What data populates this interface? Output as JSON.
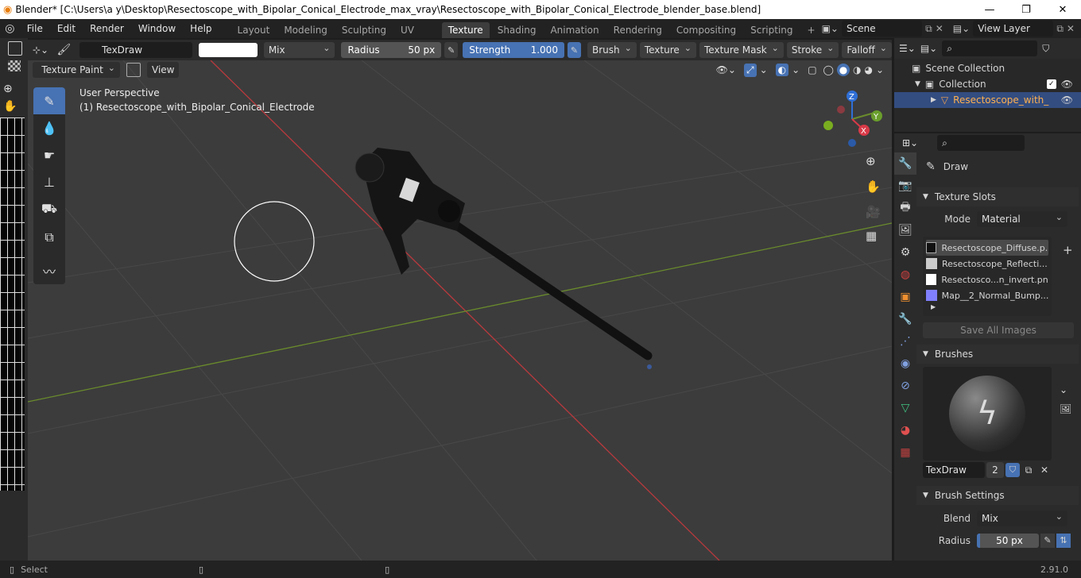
{
  "titlebar": {
    "title": "Blender* [C:\\Users\\a y\\Desktop\\Resectoscope_with_Bipolar_Conical_Electrode_max_vray\\Resectoscope_with_Bipolar_Conical_Electrode_blender_base.blend]",
    "minimize": "—",
    "maximize": "❐",
    "close": "✕"
  },
  "menu": [
    "File",
    "Edit",
    "Render",
    "Window",
    "Help"
  ],
  "workspaces": [
    "Layout",
    "Modeling",
    "Sculpting",
    "UV Editing",
    "Texture Paint",
    "Shading",
    "Animation",
    "Rendering",
    "Compositing",
    "Scripting"
  ],
  "workspace_add": "+",
  "scene": {
    "label": "Scene"
  },
  "view_layer": {
    "label": "View Layer"
  },
  "toolheader": {
    "brush_name": "TexDraw",
    "blend": "Mix",
    "radius_label": "Radius",
    "radius_value": "50 px",
    "strength_label": "Strength",
    "strength_value": "1.000",
    "menus": [
      "Brush",
      "Texture",
      "Texture Mask",
      "Stroke",
      "Falloff"
    ]
  },
  "viewheader": {
    "mode": "Texture Paint",
    "view": "View"
  },
  "viewport": {
    "perspective": "User Perspective",
    "object": "(1) Resectoscope_with_Bipolar_Conical_Electrode",
    "gizmo": {
      "z": "Z",
      "y": "Y",
      "x": "X"
    }
  },
  "outliner": {
    "scene_collection": "Scene Collection",
    "collection": "Collection",
    "object": "Resectoscope_with_"
  },
  "properties": {
    "tool_name": "Draw",
    "texture_slots": {
      "title": "Texture Slots",
      "mode_label": "Mode",
      "mode_value": "Material",
      "slots": [
        "Resectoscope_Diffuse.p...",
        "Resectoscope_Reflecti...",
        "Resectosco...n_invert.png",
        "Map__2_Normal_Bump...."
      ],
      "save_all": "Save All Images"
    },
    "brushes": {
      "title": "Brushes",
      "name": "TexDraw",
      "users": "2"
    },
    "brush_settings": {
      "title": "Brush Settings",
      "blend_label": "Blend",
      "blend_value": "Mix",
      "radius_label": "Radius",
      "radius_value": "50 px"
    }
  },
  "statusbar": {
    "select": "Select",
    "version": "2.91.0"
  },
  "colors": {
    "accent": "#4772b3",
    "viewport_bg": "#3c3c3c",
    "x_axis": "#b9393d",
    "y_axis": "#6a8b2c",
    "active_tab": "#3d3d3d"
  }
}
